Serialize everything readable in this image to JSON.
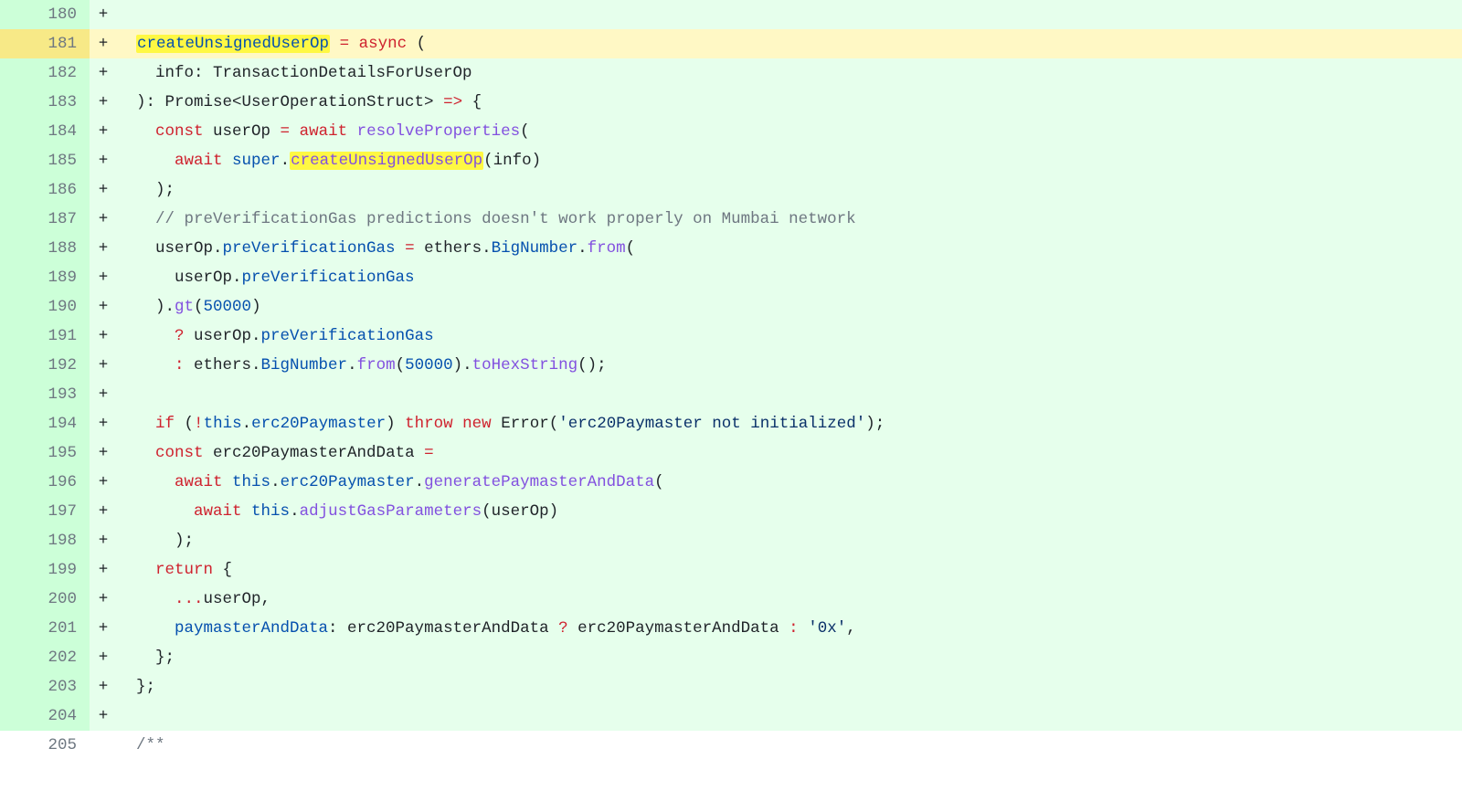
{
  "lines": [
    {
      "num": "180",
      "marker": "+",
      "rowClass": "row-added",
      "tokens": []
    },
    {
      "num": "181",
      "marker": "+",
      "rowClass": "row-hl",
      "tokens": [
        {
          "t": "  ",
          "c": "c-text"
        },
        {
          "t": "createUnsignedUserOp",
          "c": "c-blue",
          "hl": true
        },
        {
          "t": " ",
          "c": "c-text"
        },
        {
          "t": "=",
          "c": "c-red"
        },
        {
          "t": " ",
          "c": "c-text"
        },
        {
          "t": "async",
          "c": "c-red"
        },
        {
          "t": " (",
          "c": "c-text"
        }
      ]
    },
    {
      "num": "182",
      "marker": "+",
      "rowClass": "row-added",
      "tokens": [
        {
          "t": "    info: TransactionDetailsForUserOp",
          "c": "c-text"
        }
      ]
    },
    {
      "num": "183",
      "marker": "+",
      "rowClass": "row-added",
      "tokens": [
        {
          "t": "  ): Promise<UserOperationStruct> ",
          "c": "c-text"
        },
        {
          "t": "=>",
          "c": "c-red"
        },
        {
          "t": " {",
          "c": "c-text"
        }
      ]
    },
    {
      "num": "184",
      "marker": "+",
      "rowClass": "row-added",
      "tokens": [
        {
          "t": "    ",
          "c": "c-text"
        },
        {
          "t": "const",
          "c": "c-red"
        },
        {
          "t": " userOp ",
          "c": "c-text"
        },
        {
          "t": "=",
          "c": "c-red"
        },
        {
          "t": " ",
          "c": "c-text"
        },
        {
          "t": "await",
          "c": "c-red"
        },
        {
          "t": " ",
          "c": "c-text"
        },
        {
          "t": "resolveProperties",
          "c": "c-purple"
        },
        {
          "t": "(",
          "c": "c-text"
        }
      ]
    },
    {
      "num": "185",
      "marker": "+",
      "rowClass": "row-added",
      "tokens": [
        {
          "t": "      ",
          "c": "c-text"
        },
        {
          "t": "await",
          "c": "c-red"
        },
        {
          "t": " ",
          "c": "c-text"
        },
        {
          "t": "super",
          "c": "c-blue"
        },
        {
          "t": ".",
          "c": "c-text"
        },
        {
          "t": "createUnsignedUserOp",
          "c": "c-purple",
          "hl": true
        },
        {
          "t": "(info)",
          "c": "c-text"
        }
      ]
    },
    {
      "num": "186",
      "marker": "+",
      "rowClass": "row-added",
      "tokens": [
        {
          "t": "    );",
          "c": "c-text"
        }
      ]
    },
    {
      "num": "187",
      "marker": "+",
      "rowClass": "row-added",
      "tokens": [
        {
          "t": "    ",
          "c": "c-text"
        },
        {
          "t": "// preVerificationGas predictions doesn't work properly on Mumbai network",
          "c": "c-gray"
        }
      ]
    },
    {
      "num": "188",
      "marker": "+",
      "rowClass": "row-added",
      "tokens": [
        {
          "t": "    userOp.",
          "c": "c-text"
        },
        {
          "t": "preVerificationGas",
          "c": "c-blue"
        },
        {
          "t": " ",
          "c": "c-text"
        },
        {
          "t": "=",
          "c": "c-red"
        },
        {
          "t": " ethers.",
          "c": "c-text"
        },
        {
          "t": "BigNumber",
          "c": "c-blue"
        },
        {
          "t": ".",
          "c": "c-text"
        },
        {
          "t": "from",
          "c": "c-purple"
        },
        {
          "t": "(",
          "c": "c-text"
        }
      ]
    },
    {
      "num": "189",
      "marker": "+",
      "rowClass": "row-added",
      "tokens": [
        {
          "t": "      userOp.",
          "c": "c-text"
        },
        {
          "t": "preVerificationGas",
          "c": "c-blue"
        }
      ]
    },
    {
      "num": "190",
      "marker": "+",
      "rowClass": "row-added",
      "tokens": [
        {
          "t": "    ).",
          "c": "c-text"
        },
        {
          "t": "gt",
          "c": "c-purple"
        },
        {
          "t": "(",
          "c": "c-text"
        },
        {
          "t": "50000",
          "c": "c-num"
        },
        {
          "t": ")",
          "c": "c-text"
        }
      ]
    },
    {
      "num": "191",
      "marker": "+",
      "rowClass": "row-added",
      "tokens": [
        {
          "t": "      ",
          "c": "c-text"
        },
        {
          "t": "?",
          "c": "c-red"
        },
        {
          "t": " userOp.",
          "c": "c-text"
        },
        {
          "t": "preVerificationGas",
          "c": "c-blue"
        }
      ]
    },
    {
      "num": "192",
      "marker": "+",
      "rowClass": "row-added",
      "tokens": [
        {
          "t": "      ",
          "c": "c-text"
        },
        {
          "t": ":",
          "c": "c-red"
        },
        {
          "t": " ethers.",
          "c": "c-text"
        },
        {
          "t": "BigNumber",
          "c": "c-blue"
        },
        {
          "t": ".",
          "c": "c-text"
        },
        {
          "t": "from",
          "c": "c-purple"
        },
        {
          "t": "(",
          "c": "c-text"
        },
        {
          "t": "50000",
          "c": "c-num"
        },
        {
          "t": ").",
          "c": "c-text"
        },
        {
          "t": "toHexString",
          "c": "c-purple"
        },
        {
          "t": "();",
          "c": "c-text"
        }
      ]
    },
    {
      "num": "193",
      "marker": "+",
      "rowClass": "row-added",
      "tokens": []
    },
    {
      "num": "194",
      "marker": "+",
      "rowClass": "row-added",
      "tokens": [
        {
          "t": "    ",
          "c": "c-text"
        },
        {
          "t": "if",
          "c": "c-red"
        },
        {
          "t": " (",
          "c": "c-text"
        },
        {
          "t": "!",
          "c": "c-red"
        },
        {
          "t": "this",
          "c": "c-blue"
        },
        {
          "t": ".",
          "c": "c-text"
        },
        {
          "t": "erc20Paymaster",
          "c": "c-blue"
        },
        {
          "t": ") ",
          "c": "c-text"
        },
        {
          "t": "throw",
          "c": "c-red"
        },
        {
          "t": " ",
          "c": "c-text"
        },
        {
          "t": "new",
          "c": "c-red"
        },
        {
          "t": " Error(",
          "c": "c-text"
        },
        {
          "t": "'erc20Paymaster not initialized'",
          "c": "c-navy"
        },
        {
          "t": ");",
          "c": "c-text"
        }
      ]
    },
    {
      "num": "195",
      "marker": "+",
      "rowClass": "row-added",
      "tokens": [
        {
          "t": "    ",
          "c": "c-text"
        },
        {
          "t": "const",
          "c": "c-red"
        },
        {
          "t": " erc20PaymasterAndData ",
          "c": "c-text"
        },
        {
          "t": "=",
          "c": "c-red"
        }
      ]
    },
    {
      "num": "196",
      "marker": "+",
      "rowClass": "row-added",
      "tokens": [
        {
          "t": "      ",
          "c": "c-text"
        },
        {
          "t": "await",
          "c": "c-red"
        },
        {
          "t": " ",
          "c": "c-text"
        },
        {
          "t": "this",
          "c": "c-blue"
        },
        {
          "t": ".",
          "c": "c-text"
        },
        {
          "t": "erc20Paymaster",
          "c": "c-blue"
        },
        {
          "t": ".",
          "c": "c-text"
        },
        {
          "t": "generatePaymasterAndData",
          "c": "c-purple"
        },
        {
          "t": "(",
          "c": "c-text"
        }
      ]
    },
    {
      "num": "197",
      "marker": "+",
      "rowClass": "row-added",
      "tokens": [
        {
          "t": "        ",
          "c": "c-text"
        },
        {
          "t": "await",
          "c": "c-red"
        },
        {
          "t": " ",
          "c": "c-text"
        },
        {
          "t": "this",
          "c": "c-blue"
        },
        {
          "t": ".",
          "c": "c-text"
        },
        {
          "t": "adjustGasParameters",
          "c": "c-purple"
        },
        {
          "t": "(userOp)",
          "c": "c-text"
        }
      ]
    },
    {
      "num": "198",
      "marker": "+",
      "rowClass": "row-added",
      "tokens": [
        {
          "t": "      );",
          "c": "c-text"
        }
      ]
    },
    {
      "num": "199",
      "marker": "+",
      "rowClass": "row-added",
      "tokens": [
        {
          "t": "    ",
          "c": "c-text"
        },
        {
          "t": "return",
          "c": "c-red"
        },
        {
          "t": " {",
          "c": "c-text"
        }
      ]
    },
    {
      "num": "200",
      "marker": "+",
      "rowClass": "row-added",
      "tokens": [
        {
          "t": "      ",
          "c": "c-text"
        },
        {
          "t": "...",
          "c": "c-red"
        },
        {
          "t": "userOp,",
          "c": "c-text"
        }
      ]
    },
    {
      "num": "201",
      "marker": "+",
      "rowClass": "row-added",
      "tokens": [
        {
          "t": "      ",
          "c": "c-text"
        },
        {
          "t": "paymasterAndData",
          "c": "c-blue"
        },
        {
          "t": ": erc20PaymasterAndData ",
          "c": "c-text"
        },
        {
          "t": "?",
          "c": "c-red"
        },
        {
          "t": " erc20PaymasterAndData ",
          "c": "c-text"
        },
        {
          "t": ":",
          "c": "c-red"
        },
        {
          "t": " ",
          "c": "c-text"
        },
        {
          "t": "'0x'",
          "c": "c-navy"
        },
        {
          "t": ",",
          "c": "c-text"
        }
      ]
    },
    {
      "num": "202",
      "marker": "+",
      "rowClass": "row-added",
      "tokens": [
        {
          "t": "    };",
          "c": "c-text"
        }
      ]
    },
    {
      "num": "203",
      "marker": "+",
      "rowClass": "row-added",
      "tokens": [
        {
          "t": "  };",
          "c": "c-text"
        }
      ]
    },
    {
      "num": "204",
      "marker": "+",
      "rowClass": "row-added",
      "tokens": []
    },
    {
      "num": "205",
      "marker": "",
      "rowClass": "row-ctx",
      "tokens": [
        {
          "t": "  ",
          "c": "c-text"
        },
        {
          "t": "/**",
          "c": "c-gray"
        }
      ]
    }
  ]
}
